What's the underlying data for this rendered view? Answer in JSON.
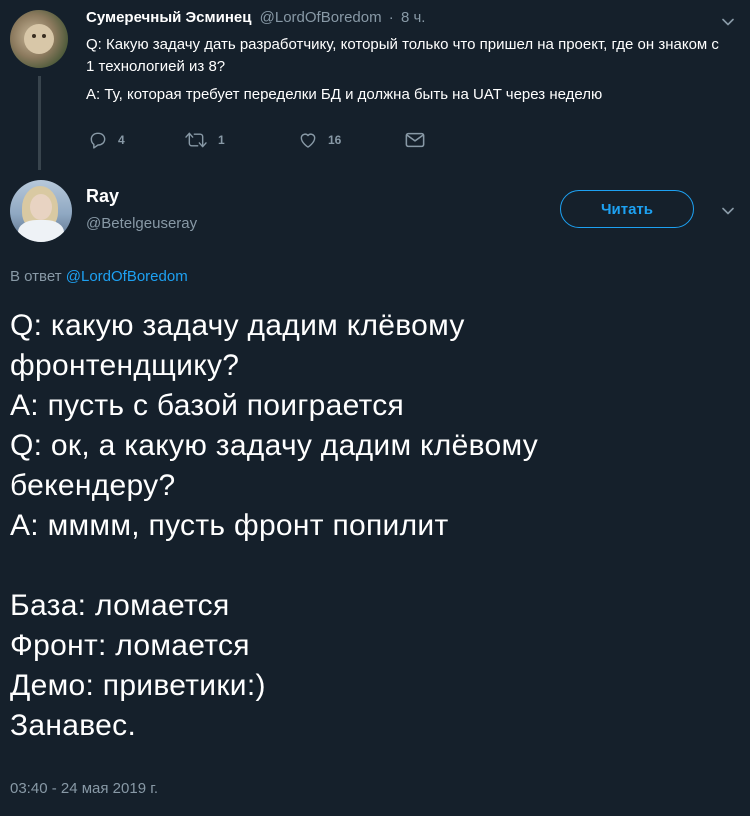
{
  "parent_tweet": {
    "name": "Сумеречный Эсминец",
    "handle": "@LordOfBoredom",
    "separator": "·",
    "time": "8 ч.",
    "lines": [
      "Q: Какую задачу дать разработчику, который только что пришел на проект, где он знаком с 1 технологией из 8?",
      "A: Ту, которая требует переделки БД и должна быть на UAT через неделю"
    ],
    "actions": {
      "reply_count": "4",
      "retweet_count": "1",
      "like_count": "16"
    }
  },
  "main_tweet": {
    "name": "Ray",
    "handle": "@Betelgeuseray",
    "follow_label": "Читать",
    "reply_prefix": "В ответ",
    "reply_to": "@LordOfBoredom",
    "lines": [
      "Q: какую задачу дадим клёвому",
      "фронтендщику?",
      "A: пусть с базой поиграется",
      "Q: ок, а какую задачу дадим клёвому",
      "бекендеру?",
      "A: мммм, пусть фронт попилит",
      "",
      "База: ломается",
      "Фронт: ломается",
      "Демо: приветики:)",
      "Занавес."
    ],
    "timestamp": "03:40 - 24 мая 2019 г."
  },
  "colors": {
    "background": "#15202b",
    "accent": "#1da1f2",
    "secondary_text": "#8899a6",
    "thread_line": "#38444d"
  },
  "icons": [
    "reply-icon",
    "retweet-icon",
    "like-icon",
    "message-icon",
    "chevron-down-icon"
  ]
}
